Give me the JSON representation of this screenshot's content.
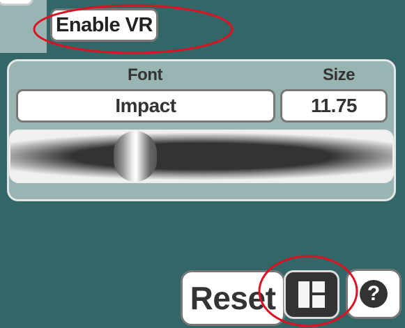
{
  "vr": {
    "label": "Enable VR"
  },
  "font_panel": {
    "font_label": "Font",
    "size_label": "Size",
    "font_value": "Impact",
    "size_value": "11.75"
  },
  "controls": {
    "reset_label": "Reset",
    "help_symbol": "?"
  },
  "colors": {
    "background": "#336666",
    "panel": "#99b5b3",
    "annotation": "#dd1122"
  },
  "icons": [
    "layout-grid-icon",
    "help-icon"
  ]
}
